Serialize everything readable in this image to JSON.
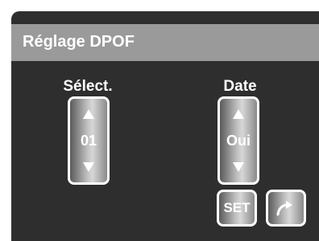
{
  "header": {
    "title": "Réglage DPOF"
  },
  "select_column": {
    "label": "Sélect.",
    "value": "01",
    "up_icon": "triangle-up-icon",
    "down_icon": "triangle-down-icon"
  },
  "date_column": {
    "label": "Date",
    "value": "Oui",
    "up_icon": "triangle-up-icon",
    "down_icon": "triangle-down-icon"
  },
  "buttons": {
    "set_label": "SET",
    "next_icon": "curved-arrow-right-icon"
  },
  "colors": {
    "background": "#2e2e2e",
    "title_bar": "#9a9a9a",
    "text": "#ffffff"
  }
}
